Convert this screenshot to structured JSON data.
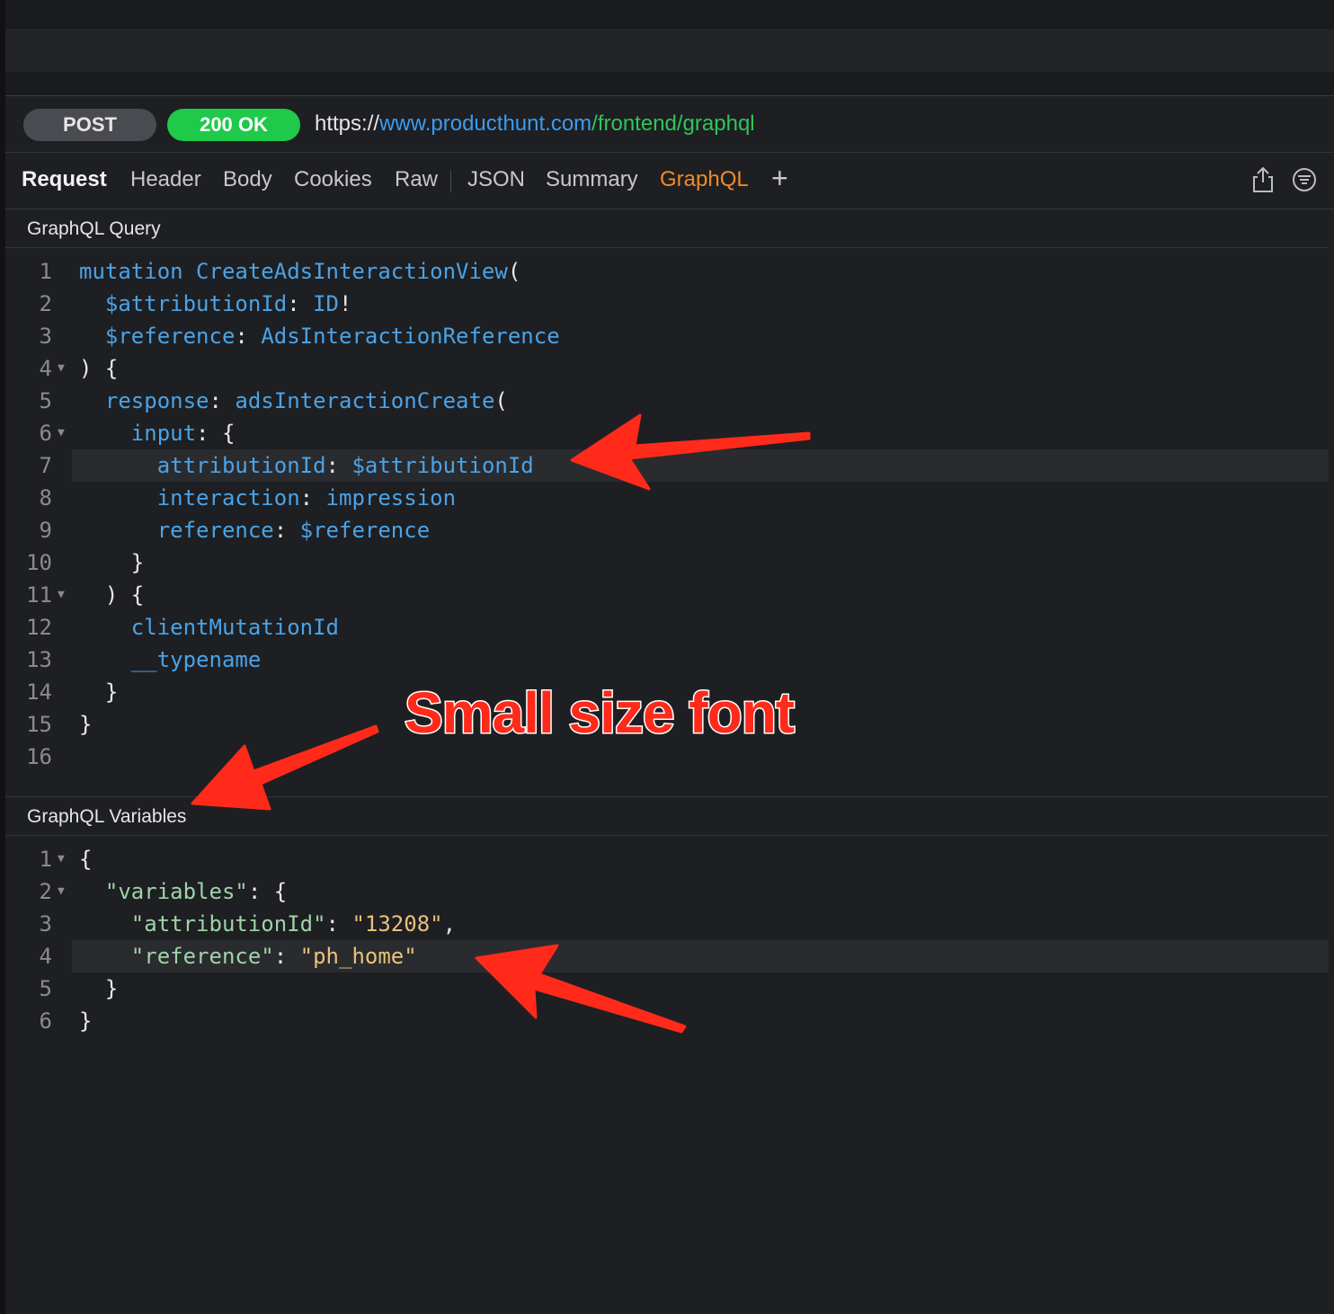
{
  "request": {
    "method": "POST",
    "status": "200 OK",
    "url_scheme": "https://",
    "url_host": "www.producthunt.com",
    "url_path": "/frontend/graphql"
  },
  "tabs": {
    "title": "Request",
    "items": [
      "Header",
      "Body",
      "Cookies",
      "Raw",
      "JSON",
      "Summary",
      "GraphQL"
    ],
    "active": "GraphQL",
    "add": "+"
  },
  "query_section": {
    "title": "GraphQL Query",
    "lines": [
      "1",
      "2",
      "3",
      "4",
      "5",
      "6",
      "7",
      "8",
      "9",
      "10",
      "11",
      "12",
      "13",
      "14",
      "15",
      "16"
    ]
  },
  "variables_section": {
    "title": "GraphQL Variables"
  },
  "annotation": {
    "text": "Small size font"
  },
  "colors": {
    "background": "#1e1f22",
    "status_green": "#1fc94a",
    "active_tab": "#f08a2a",
    "url_host": "#3a9cf0",
    "url_path": "#2fc55a",
    "annotation_red": "#ff2a1a"
  }
}
